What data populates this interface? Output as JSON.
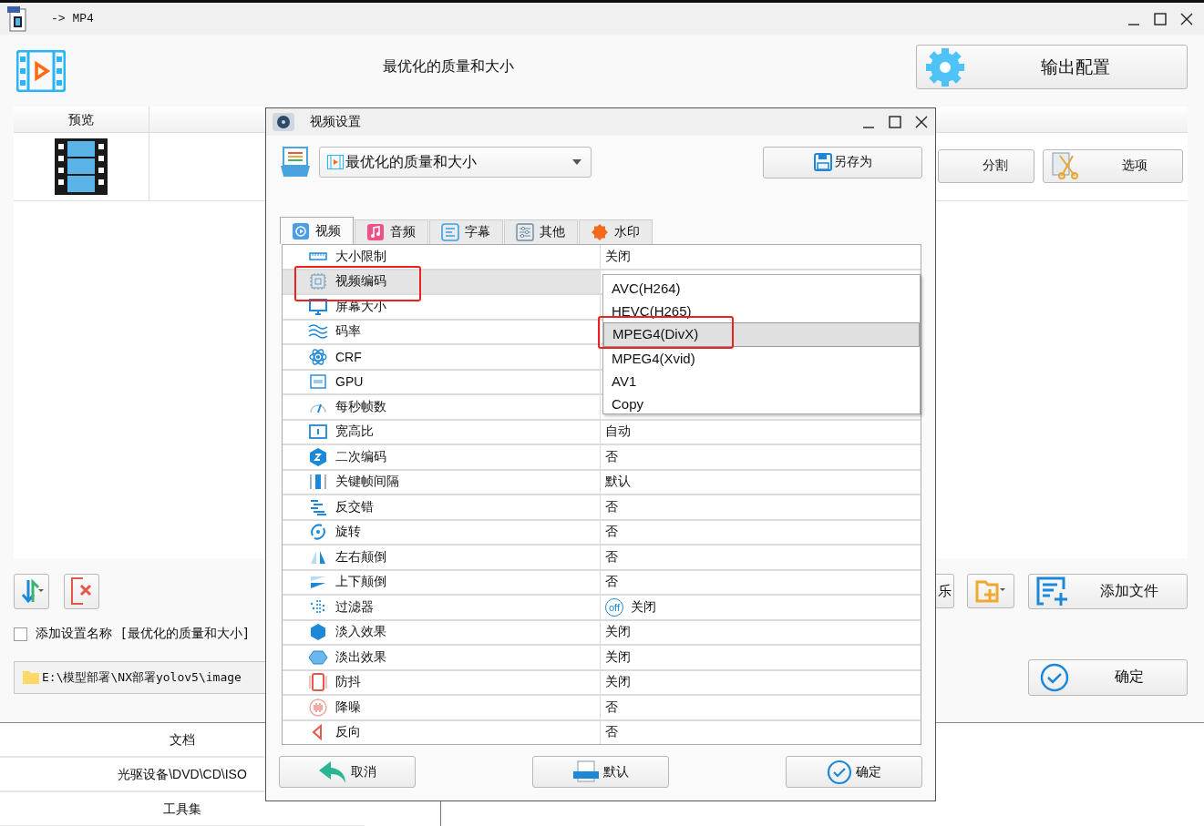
{
  "main_window": {
    "title": "-> MP4",
    "preset_title": "最优化的质量和大小",
    "output_button": "输出配置",
    "list": {
      "columns": [
        "预览"
      ]
    },
    "split_button": "分割",
    "options_button": "选项",
    "partial_button": "乐",
    "add_file_button": "添加文件",
    "add_name_checkbox": {
      "label": "添加设置名称 [最优化的质量和大小]",
      "checked": false
    },
    "path": "E:\\模型部署\\NX部署yolov5\\image",
    "ok_button": "确定"
  },
  "background_list": [
    "文档",
    "光驱设备\\DVD\\CD\\ISO",
    "工具集"
  ],
  "dialog": {
    "title": "视频设置",
    "preset": "最优化的质量和大小",
    "save_as_button": "另存为",
    "tabs": [
      {
        "label": "视频",
        "selected": true
      },
      {
        "label": "音频",
        "selected": false
      },
      {
        "label": "字幕",
        "selected": false
      },
      {
        "label": "其他",
        "selected": false
      },
      {
        "label": "水印",
        "selected": false
      }
    ],
    "settings": [
      {
        "name": "大小限制",
        "value": "关闭",
        "selected": false
      },
      {
        "name": "视频编码",
        "selected": true
      },
      {
        "name": "屏幕大小",
        "selected": false
      },
      {
        "name": "码率",
        "selected": false
      },
      {
        "name": "CRF",
        "selected": false
      },
      {
        "name": "GPU",
        "selected": false
      },
      {
        "name": "每秒帧数",
        "selected": false
      },
      {
        "name": "宽高比",
        "value": "自动",
        "selected": false
      },
      {
        "name": "二次编码",
        "value": "否",
        "selected": false
      },
      {
        "name": "关键帧间隔",
        "value": "默认",
        "selected": false
      },
      {
        "name": "反交错",
        "value": "否",
        "selected": false
      },
      {
        "name": "旋转",
        "value": "否",
        "selected": false
      },
      {
        "name": "左右颠倒",
        "value": "否",
        "selected": false
      },
      {
        "name": "上下颠倒",
        "value": "否",
        "selected": false
      },
      {
        "name": "过滤器",
        "value": "关闭",
        "badge": "off",
        "selected": false
      },
      {
        "name": "淡入效果",
        "value": "关闭",
        "selected": false
      },
      {
        "name": "淡出效果",
        "value": "关闭",
        "selected": false
      },
      {
        "name": "防抖",
        "value": "关闭",
        "selected": false
      },
      {
        "name": "降噪",
        "value": "否",
        "selected": false
      },
      {
        "name": "反向",
        "value": "否",
        "selected": false
      }
    ],
    "dropdown": {
      "options": [
        {
          "label": "AVC(H264)",
          "selected": false
        },
        {
          "label": "HEVC(H265)",
          "selected": false
        },
        {
          "label": "MPEG4(DivX)",
          "selected": true
        },
        {
          "label": "MPEG4(Xvid)",
          "selected": false
        },
        {
          "label": "AV1",
          "selected": false
        },
        {
          "label": "Copy",
          "selected": false
        }
      ]
    },
    "buttons": [
      {
        "kind": "cancel",
        "label": "取消"
      },
      {
        "kind": "default",
        "label": "默认"
      },
      {
        "kind": "ok",
        "label": "确定"
      }
    ]
  }
}
